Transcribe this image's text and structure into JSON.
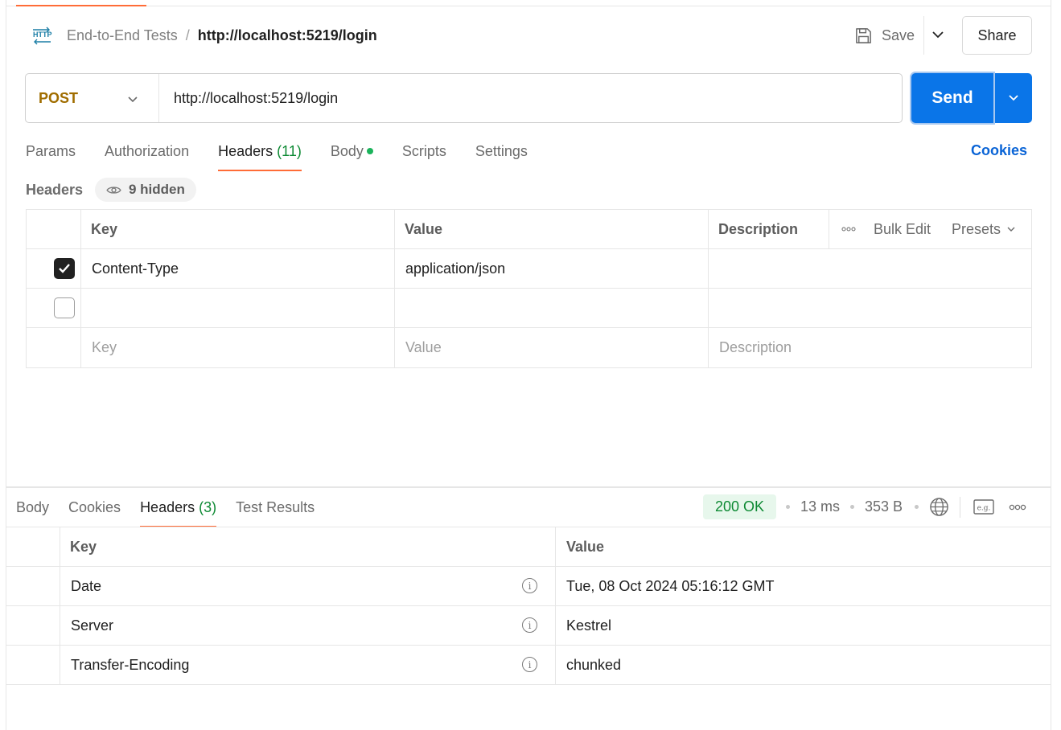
{
  "breadcrumb": {
    "icon": "http-icon",
    "parent": "End-to-End Tests",
    "separator": "/",
    "current": "http://localhost:5219/login"
  },
  "toolbar": {
    "save_label": "Save",
    "share_label": "Share"
  },
  "request": {
    "method": "POST",
    "url": "http://localhost:5219/login",
    "send_label": "Send"
  },
  "request_tabs": {
    "params": "Params",
    "authorization": "Authorization",
    "headers": "Headers",
    "headers_count": "(11)",
    "body": "Body",
    "scripts": "Scripts",
    "settings": "Settings",
    "cookies": "Cookies"
  },
  "headers_panel": {
    "title": "Headers",
    "hidden_label": "9 hidden",
    "columns": {
      "key": "Key",
      "value": "Value",
      "description": "Description"
    },
    "bulk_edit": "Bulk Edit",
    "presets": "Presets",
    "rows": [
      {
        "checked": true,
        "key": "Content-Type",
        "value": "application/json",
        "description": ""
      },
      {
        "checked": false,
        "key": "",
        "value": "",
        "description": ""
      }
    ],
    "placeholders": {
      "key": "Key",
      "value": "Value",
      "description": "Description"
    }
  },
  "response_tabs": {
    "body": "Body",
    "cookies": "Cookies",
    "headers": "Headers",
    "headers_count": "(3)",
    "test_results": "Test Results"
  },
  "response_meta": {
    "status": "200 OK",
    "time": "13 ms",
    "size": "353 B"
  },
  "response_headers": {
    "columns": {
      "key": "Key",
      "value": "Value"
    },
    "rows": [
      {
        "key": "Date",
        "value": "Tue, 08 Oct 2024 05:16:12 GMT"
      },
      {
        "key": "Server",
        "value": "Kestrel"
      },
      {
        "key": "Transfer-Encoding",
        "value": "chunked"
      }
    ]
  },
  "colors": {
    "accent": "#ff6c37",
    "send_blue": "#0a75e8",
    "method_post": "#a06d00",
    "status_green": "#0e8a34"
  }
}
